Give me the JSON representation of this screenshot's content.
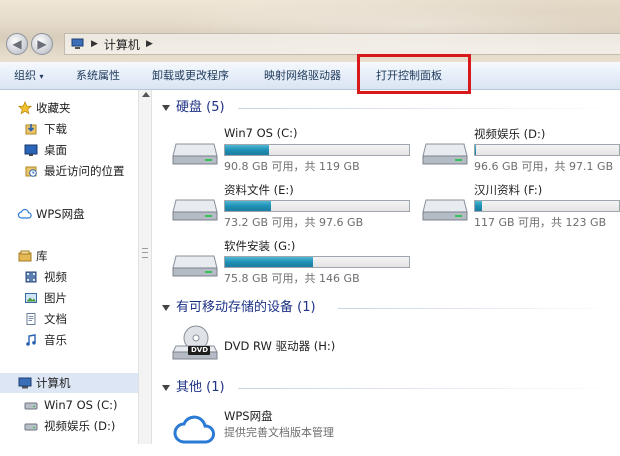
{
  "address": {
    "path": [
      "计算机"
    ]
  },
  "toolbar": {
    "organize": "组织",
    "items": [
      "系统属性",
      "卸载或更改程序",
      "映射网络驱动器",
      "打开控制面板"
    ]
  },
  "nav": {
    "favorites": "收藏夹",
    "downloads": "下载",
    "desktop": "桌面",
    "recent": "最近访问的位置",
    "wps": "WPS网盘",
    "library": "库",
    "videos": "视频",
    "pictures": "图片",
    "documents": "文档",
    "music": "音乐",
    "computer": "计算机",
    "drive_c": "Win7 OS (C:)",
    "drive_d": "视频娱乐 (D:)"
  },
  "groups": {
    "hdd": "硬盘 (5)",
    "removable": "有可移动存储的设备 (1)",
    "other": "其他 (1)"
  },
  "drives": [
    {
      "name": "Win7 OS (C:)",
      "info": "90.8 GB 可用，共 119 GB",
      "used_fraction": 0.24
    },
    {
      "name": "视频娱乐 (D:)",
      "info": "96.6 GB 可用，共 97.1 GB",
      "used_fraction": 0.01
    },
    {
      "name": "资料文件 (E:)",
      "info": "73.2 GB 可用，共 97.6 GB",
      "used_fraction": 0.25
    },
    {
      "name": "汉川资料 (F:)",
      "info": "117 GB 可用，共 123 GB",
      "used_fraction": 0.05
    },
    {
      "name": "软件安装 (G:)",
      "info": "75.8 GB 可用，共 146 GB",
      "used_fraction": 0.48
    }
  ],
  "dvd": {
    "name": "DVD RW 驱动器 (H:)",
    "badge": "DVD"
  },
  "wps_item": {
    "name": "WPS网盘",
    "desc": "提供完善文档版本管理"
  }
}
